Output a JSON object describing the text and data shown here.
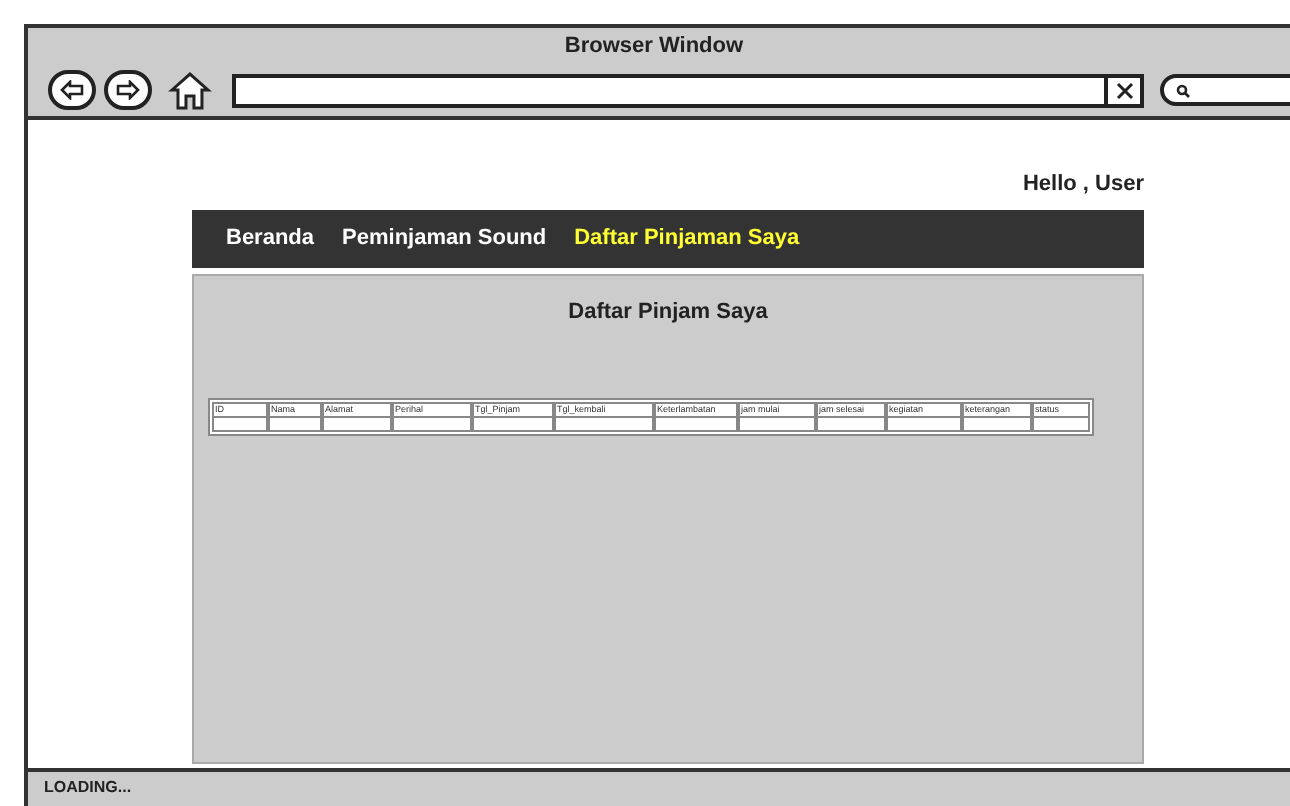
{
  "window": {
    "title": "Browser Window"
  },
  "greeting": "Hello , User",
  "nav": [
    {
      "label": "Beranda",
      "selected": false
    },
    {
      "label": "Peminjaman Sound",
      "selected": false
    },
    {
      "label": "Daftar Pinjaman Saya",
      "selected": true
    }
  ],
  "page_title": "Daftar Pinjam Saya",
  "table": {
    "columns": [
      "ID",
      "Nama",
      "Alamat",
      "Perihal",
      "Tgl_Pinjam",
      "Tgl_kembali",
      "Keterlambatan",
      "jam mulai",
      "jam selesai",
      "kegiatan",
      "keterangan",
      "status"
    ]
  },
  "status_bar": "LOADING..."
}
